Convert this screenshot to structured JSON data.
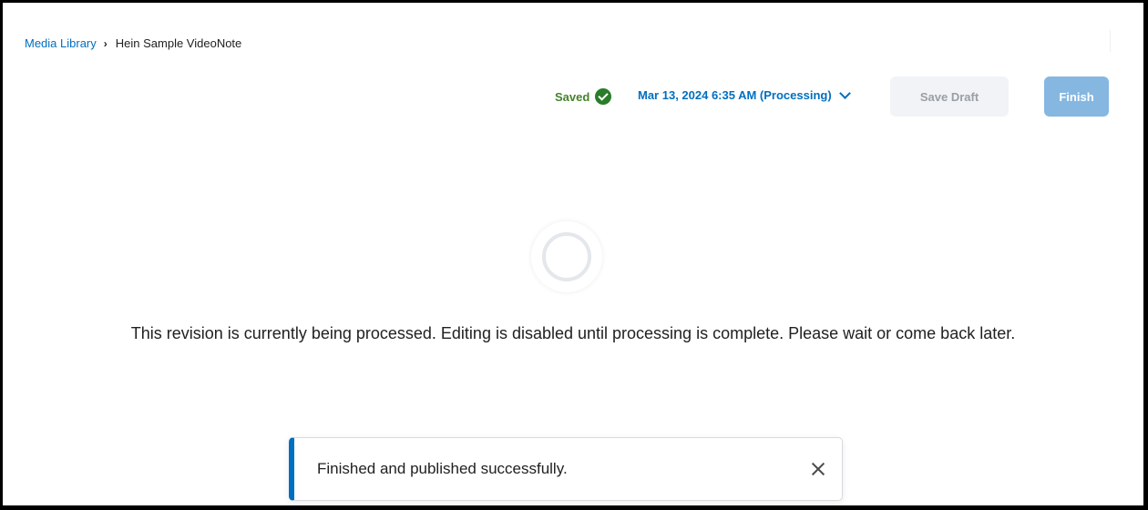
{
  "breadcrumb": {
    "parent_label": "Media Library",
    "separator": "›",
    "current_label": "Hein Sample VideoNote"
  },
  "toolbar": {
    "saved_label": "Saved",
    "saved_icon": "check-circle-icon",
    "revision_label": "Mar 13, 2024 6:35 AM (Processing)",
    "save_draft_label": "Save Draft",
    "finish_label": "Finish"
  },
  "main": {
    "processing_message": "This revision is currently being processed. Editing is disabled until processing is complete. Please wait or come back later."
  },
  "toast": {
    "message": "Finished and published successfully."
  },
  "colors": {
    "accent": "#006fbf",
    "saved_green": "#2a7d2a",
    "finish_disabled": "#85b7e0",
    "draft_disabled_bg": "#f1f3f6"
  }
}
